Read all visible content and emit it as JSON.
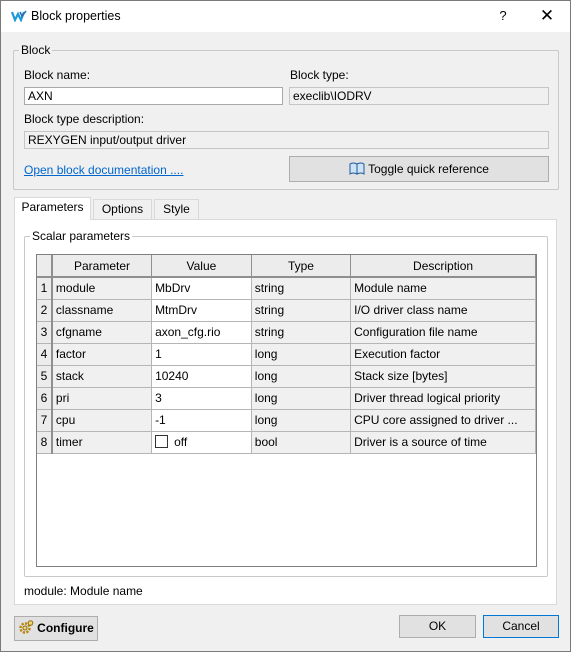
{
  "window": {
    "title": "Block properties",
    "help_label": "?",
    "close_label": "✕"
  },
  "block": {
    "group_label": "Block",
    "name_label": "Block name:",
    "name_value": "AXN",
    "type_label": "Block type:",
    "type_value": "execlib\\IODRV",
    "desc_label": "Block type description:",
    "desc_value": "REXYGEN input/output driver",
    "doc_link": "Open block documentation ....",
    "toggle_label": "Toggle quick reference"
  },
  "tabs": [
    {
      "label": "Parameters",
      "active": true
    },
    {
      "label": "Options",
      "active": false
    },
    {
      "label": "Style",
      "active": false
    }
  ],
  "scalar": {
    "group_label": "Scalar parameters",
    "columns": [
      "Parameter",
      "Value",
      "Type",
      "Description"
    ],
    "rows": [
      {
        "n": "1",
        "param": "module",
        "value": "MbDrv",
        "type": "string",
        "desc": "Module name"
      },
      {
        "n": "2",
        "param": "classname",
        "value": "MtmDrv",
        "type": "string",
        "desc": "I/O driver class name"
      },
      {
        "n": "3",
        "param": "cfgname",
        "value": "axon_cfg.rio",
        "type": "string",
        "desc": "Configuration file name"
      },
      {
        "n": "4",
        "param": "factor",
        "value": "1",
        "type": "long",
        "desc": "Execution factor"
      },
      {
        "n": "5",
        "param": "stack",
        "value": "10240",
        "type": "long",
        "desc": "Stack size [bytes]"
      },
      {
        "n": "6",
        "param": "pri",
        "value": "3",
        "type": "long",
        "desc": "Driver thread logical priority"
      },
      {
        "n": "7",
        "param": "cpu",
        "value": "-1",
        "type": "long",
        "desc": "CPU core assigned to driver ..."
      },
      {
        "n": "8",
        "param": "timer",
        "value": "off",
        "type": "bool",
        "desc": "Driver is a source of time"
      }
    ]
  },
  "status_text": "module: Module name",
  "buttons": {
    "configure": "Configure",
    "ok": "OK",
    "cancel": "Cancel"
  },
  "colors": {
    "accent": "#0078d7",
    "link": "#0066cc",
    "logo": "#1e9ad6"
  }
}
